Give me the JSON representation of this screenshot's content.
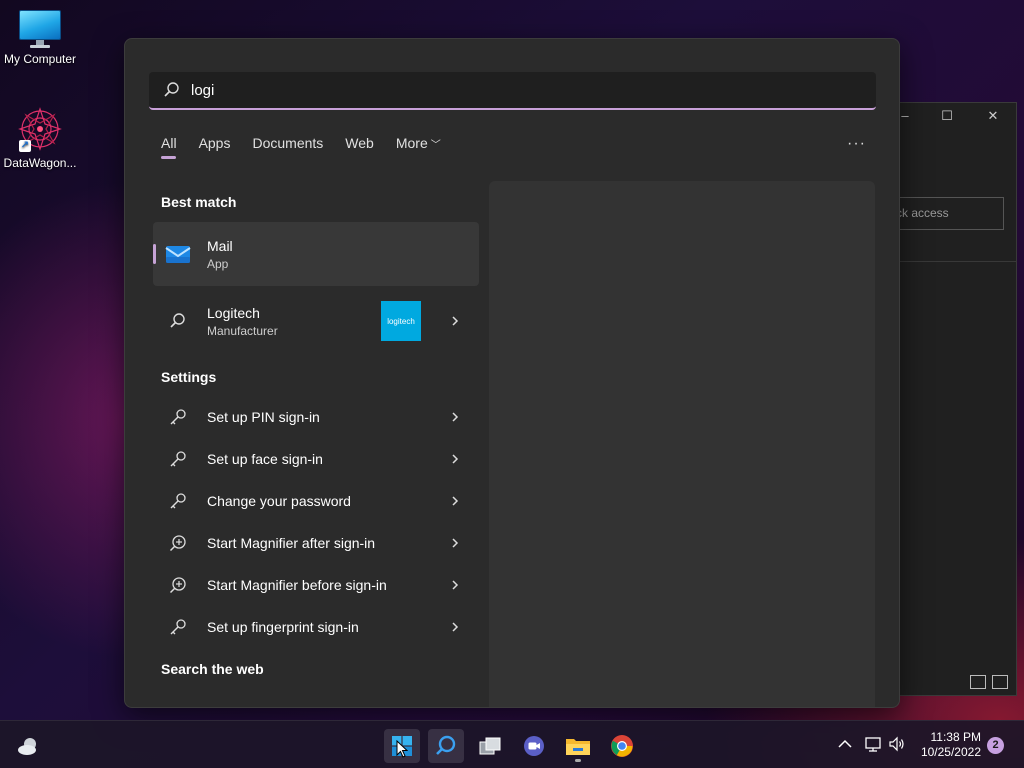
{
  "desktop": {
    "icons": [
      {
        "label": "My Computer",
        "icon": "computer-icon"
      },
      {
        "label": "DataWagon...",
        "icon": "mandala-app-icon"
      }
    ]
  },
  "background_window": {
    "search_placeholder": "ck access"
  },
  "search": {
    "query": "logi",
    "tabs": [
      "All",
      "Apps",
      "Documents",
      "Web",
      "More"
    ],
    "active_tab": "All",
    "more_options_label": "···"
  },
  "best_match": {
    "section_title": "Best match",
    "title": "Mail",
    "subtitle": "App",
    "icon": "mail-icon"
  },
  "secondary_match": {
    "title": "Logitech",
    "subtitle": "Manufacturer",
    "logo_text": "logitech",
    "icon": "search-icon"
  },
  "settings": {
    "section_title": "Settings",
    "items": [
      {
        "label": "Set up PIN sign-in",
        "icon": "key-icon"
      },
      {
        "label": "Set up face sign-in",
        "icon": "key-icon"
      },
      {
        "label": "Change your password",
        "icon": "key-icon"
      },
      {
        "label": "Start Magnifier after sign-in",
        "icon": "magnifier-icon"
      },
      {
        "label": "Start Magnifier before sign-in",
        "icon": "magnifier-icon"
      },
      {
        "label": "Set up fingerprint sign-in",
        "icon": "key-icon"
      }
    ]
  },
  "web": {
    "section_title": "Search the web"
  },
  "taskbar": {
    "time": "11:38 PM",
    "date": "10/25/2022",
    "notification_count": "2",
    "apps": [
      "start-icon",
      "search-icon",
      "task-view-icon",
      "chat-icon",
      "file-explorer-icon",
      "chrome-icon"
    ]
  },
  "colors": {
    "accent": "#c6a3d6",
    "flyout_bg": "#2b2b2b",
    "logitech_blue": "#00a9e0"
  }
}
